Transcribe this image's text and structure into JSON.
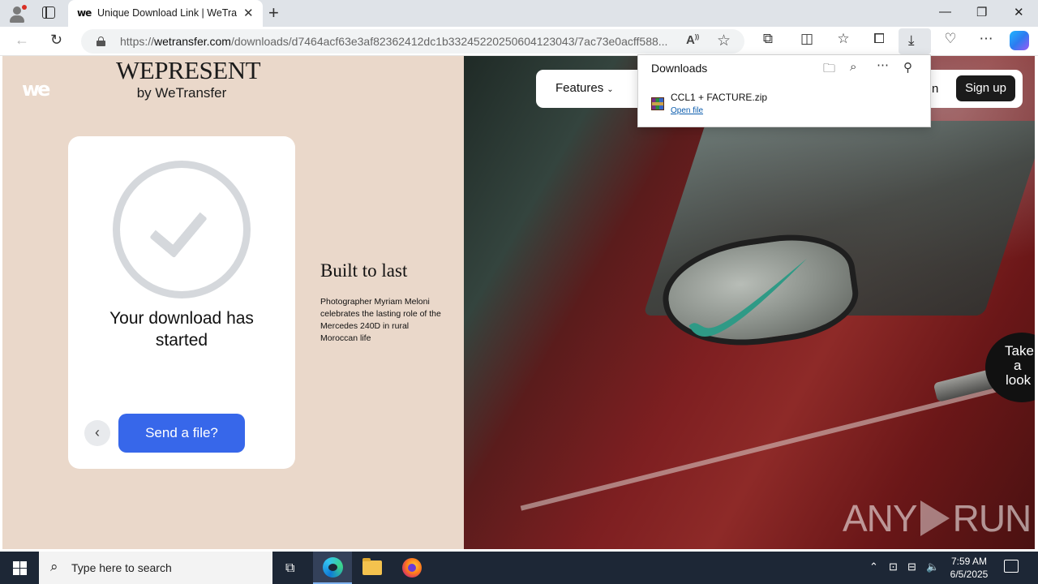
{
  "browser": {
    "tab_title": "Unique Download Link | WeTransfer",
    "tab_favicon": "we",
    "url_prefix": "https://",
    "url_host": "wetransfer.com",
    "url_path": "/downloads/d7464acf63e3af82362412dc1b332452202506041230​43/7ac73e0acff588..."
  },
  "downloads": {
    "title": "Downloads",
    "items": [
      {
        "name": "CCL1 + FACTURE.zip",
        "action": "Open file"
      }
    ]
  },
  "page": {
    "we_logo": "we",
    "wepresent_title": "WEPRESENT",
    "wepresent_sub": "by WeTransfer",
    "card": {
      "title": "Your download has started",
      "send_button": "Send a file?",
      "prev_symbol": "‹"
    },
    "story": {
      "title": "Built to last",
      "text": "Photographer Myriam Meloni celebrates the lasting role of the Mercedes 240D in rural Moroccan life"
    },
    "nav": {
      "features": "Features",
      "login_fragment": "n",
      "signup": "Sign up"
    },
    "take_a_look": [
      "Take",
      "a",
      "look"
    ],
    "watermark": {
      "left": "ANY",
      "right": "RUN"
    }
  },
  "taskbar": {
    "search_placeholder": "Type here to search",
    "time": "7:59 AM",
    "date": "6/5/2025"
  },
  "icons": {
    "back": "back-arrow-icon",
    "reload": "reload-icon",
    "download": "download-icon",
    "settings": "more-icon"
  },
  "colors": {
    "send_button": "#3767ea",
    "left_pane": "#ead8ca",
    "signup": "#1b1b1b"
  }
}
